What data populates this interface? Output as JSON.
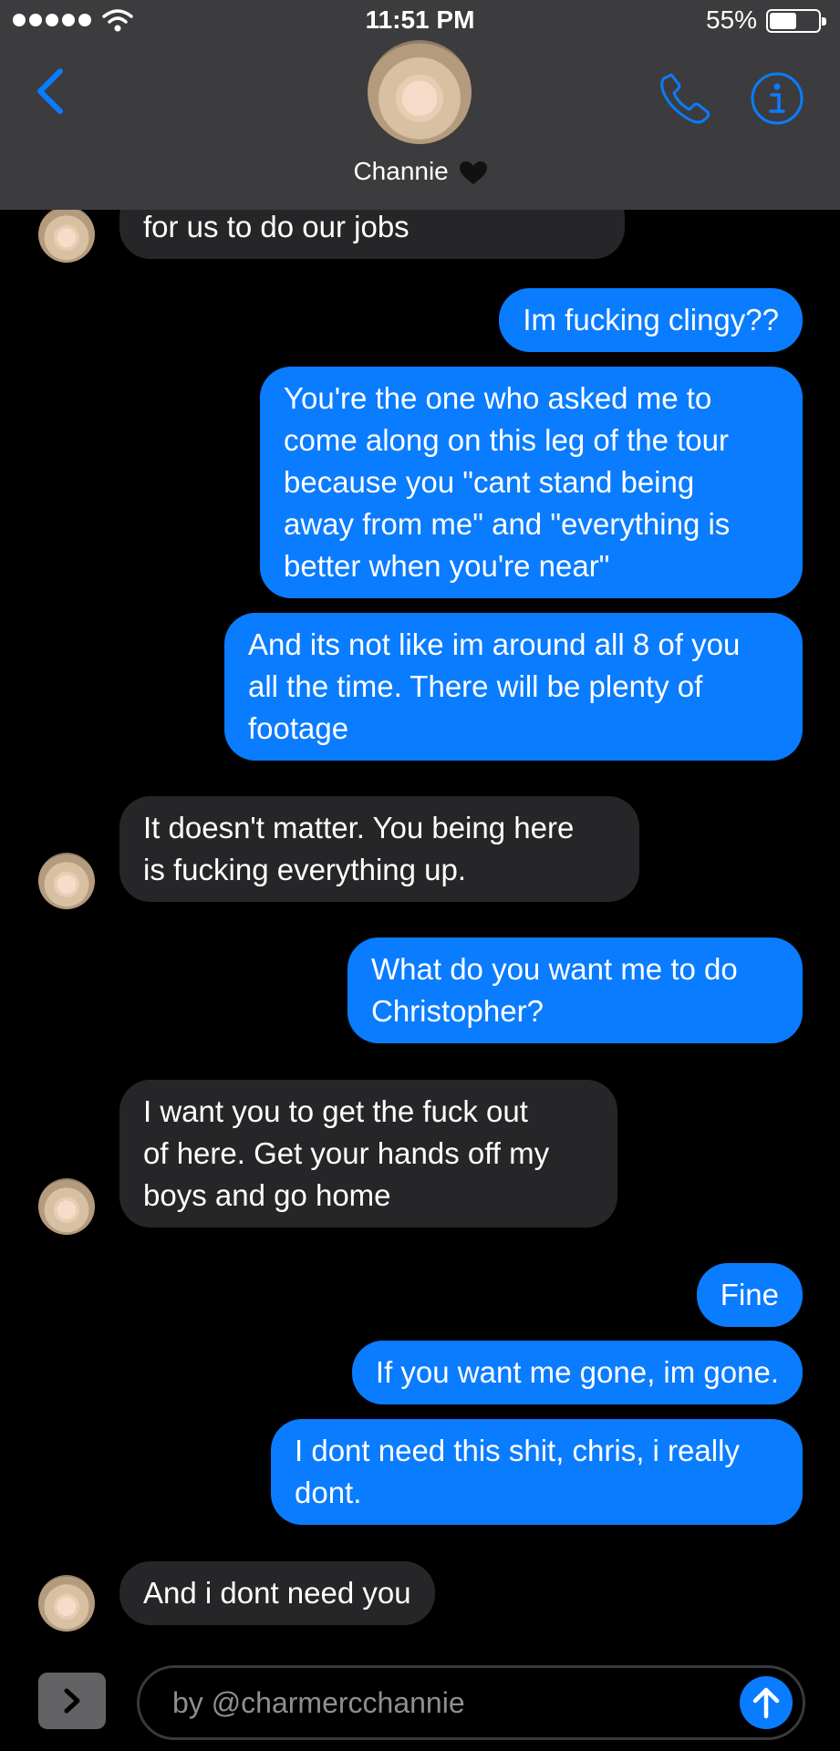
{
  "status_bar": {
    "time": "11:51 PM",
    "battery_percent": "55%",
    "battery_level": 0.55,
    "icons": [
      "signal-dots-icon",
      "wifi-icon",
      "battery-icon"
    ]
  },
  "header": {
    "contact_name": "Channie",
    "name_suffix_icon": "black-heart-icon",
    "icons": [
      "back-chevron-icon",
      "phone-icon",
      "info-icon"
    ],
    "accent_color": "#0a7cff"
  },
  "messages": [
    {
      "direction": "incoming",
      "text": "for us to do our jobs"
    },
    {
      "direction": "outgoing",
      "text": "Im fucking clingy??"
    },
    {
      "direction": "outgoing",
      "text": "You're the one who asked me to\ncome along on this leg of the tour\nbecause you \"cant stand being\naway from me\" and \"everything is\nbetter when you're near\""
    },
    {
      "direction": "outgoing",
      "text": "And its not like im around all 8 of you\nall the time. There will be plenty of\nfootage"
    },
    {
      "direction": "incoming",
      "text": "It doesn't matter. You being here\nis fucking everything up."
    },
    {
      "direction": "outgoing",
      "text": "What do you want me to do\nChristopher?"
    },
    {
      "direction": "incoming",
      "text": "I want you to get the fuck out\nof here. Get your hands off my\nboys and go home"
    },
    {
      "direction": "outgoing",
      "text": "Fine"
    },
    {
      "direction": "outgoing",
      "text": "If you want me gone, im gone."
    },
    {
      "direction": "outgoing",
      "text": "I dont need this shit, chris, i really\ndont."
    },
    {
      "direction": "incoming",
      "text": "And i dont need you"
    }
  ],
  "input_bar": {
    "placeholder": "by @charmercchannie",
    "icons": [
      "apps-chevron-icon",
      "send-arrow-icon"
    ]
  },
  "colors": {
    "header_bg": "#3c3c3e",
    "incoming_bubble": "#262628",
    "outgoing_bubble": "#0a7cff",
    "background": "#000000"
  }
}
